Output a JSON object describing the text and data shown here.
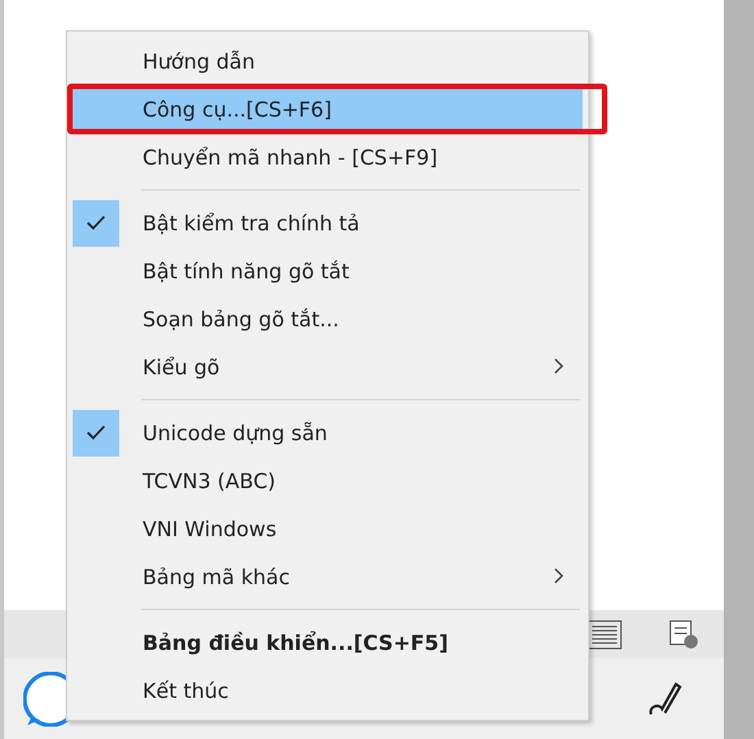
{
  "menu": {
    "items": [
      {
        "kind": "item",
        "label": "Hướng dẫn",
        "selected": false,
        "checked": false,
        "bold": false,
        "submenu": false,
        "annotated": false
      },
      {
        "kind": "item",
        "label": "Công cụ...[CS+F6]",
        "selected": true,
        "checked": false,
        "bold": false,
        "submenu": false,
        "annotated": true
      },
      {
        "kind": "item",
        "label": "Chuyển mã nhanh - [CS+F9]",
        "selected": false,
        "checked": false,
        "bold": false,
        "submenu": false,
        "annotated": false
      },
      {
        "kind": "separator"
      },
      {
        "kind": "item",
        "label": "Bật kiểm tra chính tả",
        "selected": false,
        "checked": true,
        "bold": false,
        "submenu": false,
        "annotated": false
      },
      {
        "kind": "item",
        "label": "Bật tính năng gõ tắt",
        "selected": false,
        "checked": false,
        "bold": false,
        "submenu": false,
        "annotated": false
      },
      {
        "kind": "item",
        "label": "Soạn bảng gõ tắt...",
        "selected": false,
        "checked": false,
        "bold": false,
        "submenu": false,
        "annotated": false
      },
      {
        "kind": "item",
        "label": "Kiểu gõ",
        "selected": false,
        "checked": false,
        "bold": false,
        "submenu": true,
        "annotated": false
      },
      {
        "kind": "separator"
      },
      {
        "kind": "item",
        "label": "Unicode dựng sẵn",
        "selected": false,
        "checked": true,
        "bold": false,
        "submenu": false,
        "annotated": false
      },
      {
        "kind": "item",
        "label": "TCVN3 (ABC)",
        "selected": false,
        "checked": false,
        "bold": false,
        "submenu": false,
        "annotated": false
      },
      {
        "kind": "item",
        "label": "VNI Windows",
        "selected": false,
        "checked": false,
        "bold": false,
        "submenu": false,
        "annotated": false
      },
      {
        "kind": "item",
        "label": "Bảng mã khác",
        "selected": false,
        "checked": false,
        "bold": false,
        "submenu": true,
        "annotated": false
      },
      {
        "kind": "separator"
      },
      {
        "kind": "item",
        "label": "Bảng điều khiển...[CS+F5]",
        "selected": false,
        "checked": false,
        "bold": true,
        "submenu": false,
        "annotated": false
      },
      {
        "kind": "item",
        "label": "Kết thúc",
        "selected": false,
        "checked": false,
        "bold": false,
        "submenu": false,
        "annotated": false
      }
    ]
  }
}
